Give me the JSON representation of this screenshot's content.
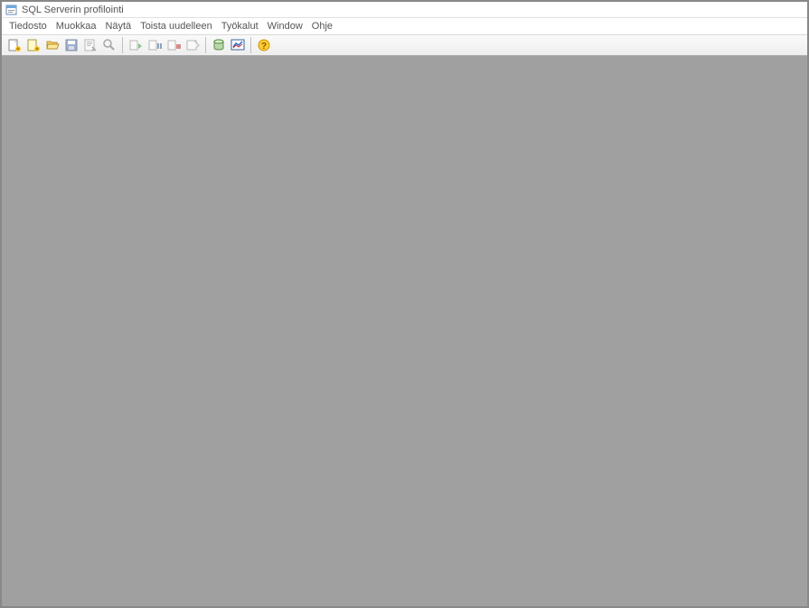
{
  "window": {
    "title": "SQL Serverin profilointi"
  },
  "menu": {
    "file": "Tiedosto",
    "edit": "Muokkaa",
    "view": "Näytä",
    "replay": "Toista uudelleen",
    "tools": "Työkalut",
    "window": "Window",
    "help": "Ohje"
  },
  "toolbar": {
    "new_trace": "new-trace",
    "new_template": "new-template",
    "open_file": "open-file",
    "save": "save",
    "properties": "properties",
    "find": "find",
    "start": "start",
    "pause": "pause",
    "stop": "stop",
    "clear": "clear",
    "db_tuning": "db-tuning",
    "activity": "activity",
    "help": "help"
  }
}
